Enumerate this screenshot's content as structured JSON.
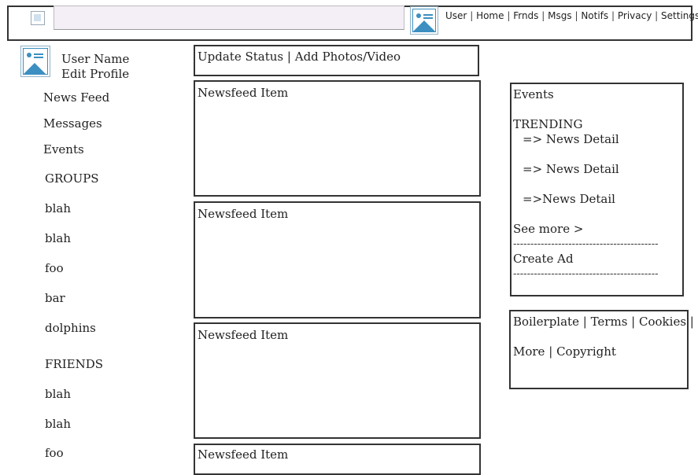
{
  "header": {
    "nav": [
      "User",
      "Home",
      "Frnds",
      "Msgs",
      "Notifs",
      "Privacy",
      "Settings"
    ],
    "separator": "|"
  },
  "profile": {
    "user_name": "User Name",
    "edit_profile": "Edit Profile"
  },
  "sidebar": {
    "news_feed": "News Feed",
    "messages": "Messages",
    "events": "Events",
    "groups_heading": "GROUPS",
    "groups": [
      "blah",
      "blah",
      "foo",
      "bar",
      "dolphins"
    ],
    "friends_heading": "FRIENDS",
    "friends": [
      "blah",
      "blah",
      "foo"
    ]
  },
  "composer": {
    "update_status": "Update Status",
    "separator": "|",
    "add_media": "Add Photos/Video"
  },
  "feed": {
    "items": [
      "Newsfeed Item",
      "Newsfeed Item",
      "Newsfeed Item",
      "Newsfeed Item"
    ]
  },
  "right_panel": {
    "events": "Events",
    "trending_heading": "TRENDING",
    "trending": [
      "=> News Detail",
      "=> News Detail",
      "=>News Detail"
    ],
    "see_more": "See more >",
    "divider": "------------------------------------------",
    "create_ad": "Create Ad"
  },
  "footer_box": {
    "boilerplate": "Boilerplate",
    "terms": "Terms",
    "cookies": "Cookies",
    "more": "More",
    "copyright": "Copyright",
    "separator": "|"
  },
  "colors": {
    "border": "#333333",
    "image_icon": "#3c8fc0",
    "search_bg": "#f4eef6"
  }
}
